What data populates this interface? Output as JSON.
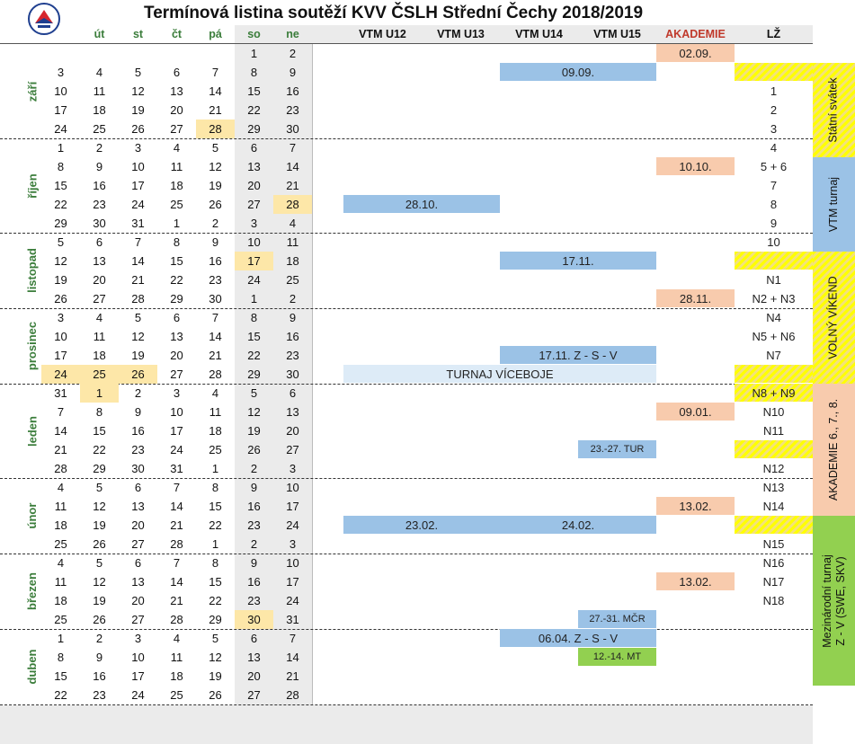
{
  "title": "Termínová listina soutěží KVV ČSLH Střední Čechy 2018/2019",
  "logo_icon": "cslh-logo-icon",
  "weekdays": [
    "út",
    "st",
    "čt",
    "pá",
    "so",
    "ne"
  ],
  "columns": [
    "VTM U12",
    "VTM U13",
    "VTM U14",
    "VTM U15",
    "AKADEMIE",
    "LŽ"
  ],
  "months": [
    {
      "name": "září",
      "weeks": [
        {
          "days": [
            "",
            "",
            "",
            "",
            "",
            "1",
            "2"
          ],
          "hl": []
        },
        {
          "days": [
            "3",
            "4",
            "5",
            "6",
            "7",
            "8",
            "9"
          ],
          "hl": []
        },
        {
          "days": [
            "10",
            "11",
            "12",
            "13",
            "14",
            "15",
            "16"
          ],
          "hl": []
        },
        {
          "days": [
            "17",
            "18",
            "19",
            "20",
            "21",
            "22",
            "23"
          ],
          "hl": []
        },
        {
          "days": [
            "24",
            "25",
            "26",
            "27",
            "28",
            "29",
            "30"
          ],
          "hl": [
            4
          ]
        }
      ]
    },
    {
      "name": "říjen",
      "weeks": [
        {
          "days": [
            "1",
            "2",
            "3",
            "4",
            "5",
            "6",
            "7"
          ],
          "hl": []
        },
        {
          "days": [
            "8",
            "9",
            "10",
            "11",
            "12",
            "13",
            "14"
          ],
          "hl": []
        },
        {
          "days": [
            "15",
            "16",
            "17",
            "18",
            "19",
            "20",
            "21"
          ],
          "hl": []
        },
        {
          "days": [
            "22",
            "23",
            "24",
            "25",
            "26",
            "27",
            "28"
          ],
          "hl": [
            6
          ]
        },
        {
          "days": [
            "29",
            "30",
            "31",
            "1",
            "2",
            "3",
            "4"
          ],
          "hl": []
        }
      ]
    },
    {
      "name": "listopad",
      "weeks": [
        {
          "days": [
            "5",
            "6",
            "7",
            "8",
            "9",
            "10",
            "11"
          ],
          "hl": []
        },
        {
          "days": [
            "12",
            "13",
            "14",
            "15",
            "16",
            "17",
            "18"
          ],
          "hl": [
            5
          ]
        },
        {
          "days": [
            "19",
            "20",
            "21",
            "22",
            "23",
            "24",
            "25"
          ],
          "hl": []
        },
        {
          "days": [
            "26",
            "27",
            "28",
            "29",
            "30",
            "1",
            "2"
          ],
          "hl": []
        }
      ]
    },
    {
      "name": "prosinec",
      "weeks": [
        {
          "days": [
            "3",
            "4",
            "5",
            "6",
            "7",
            "8",
            "9"
          ],
          "hl": []
        },
        {
          "days": [
            "10",
            "11",
            "12",
            "13",
            "14",
            "15",
            "16"
          ],
          "hl": []
        },
        {
          "days": [
            "17",
            "18",
            "19",
            "20",
            "21",
            "22",
            "23"
          ],
          "hl": []
        },
        {
          "days": [
            "24",
            "25",
            "26",
            "27",
            "28",
            "29",
            "30"
          ],
          "hl": [
            0,
            1,
            2
          ]
        }
      ]
    },
    {
      "name": "leden",
      "weeks": [
        {
          "days": [
            "31",
            "1",
            "2",
            "3",
            "4",
            "5",
            "6"
          ],
          "hl": [
            1
          ]
        },
        {
          "days": [
            "7",
            "8",
            "9",
            "10",
            "11",
            "12",
            "13"
          ],
          "hl": []
        },
        {
          "days": [
            "14",
            "15",
            "16",
            "17",
            "18",
            "19",
            "20"
          ],
          "hl": []
        },
        {
          "days": [
            "21",
            "22",
            "23",
            "24",
            "25",
            "26",
            "27"
          ],
          "hl": []
        },
        {
          "days": [
            "28",
            "29",
            "30",
            "31",
            "1",
            "2",
            "3"
          ],
          "hl": []
        }
      ]
    },
    {
      "name": "únor",
      "weeks": [
        {
          "days": [
            "4",
            "5",
            "6",
            "7",
            "8",
            "9",
            "10"
          ],
          "hl": []
        },
        {
          "days": [
            "11",
            "12",
            "13",
            "14",
            "15",
            "16",
            "17"
          ],
          "hl": []
        },
        {
          "days": [
            "18",
            "19",
            "20",
            "21",
            "22",
            "23",
            "24"
          ],
          "hl": []
        },
        {
          "days": [
            "25",
            "26",
            "27",
            "28",
            "1",
            "2",
            "3"
          ],
          "hl": []
        }
      ]
    },
    {
      "name": "březen",
      "weeks": [
        {
          "days": [
            "4",
            "5",
            "6",
            "7",
            "8",
            "9",
            "10"
          ],
          "hl": []
        },
        {
          "days": [
            "11",
            "12",
            "13",
            "14",
            "15",
            "16",
            "17"
          ],
          "hl": []
        },
        {
          "days": [
            "18",
            "19",
            "20",
            "21",
            "22",
            "23",
            "24"
          ],
          "hl": []
        },
        {
          "days": [
            "25",
            "26",
            "27",
            "28",
            "29",
            "30",
            "31"
          ],
          "hl": [
            5
          ]
        }
      ]
    },
    {
      "name": "duben",
      "weeks": [
        {
          "days": [
            "1",
            "2",
            "3",
            "4",
            "5",
            "6",
            "7"
          ],
          "hl": []
        },
        {
          "days": [
            "8",
            "9",
            "10",
            "11",
            "12",
            "13",
            "14"
          ],
          "hl": []
        },
        {
          "days": [
            "15",
            "16",
            "17",
            "18",
            "19",
            "20",
            "21"
          ],
          "hl": []
        },
        {
          "days": [
            "22",
            "23",
            "24",
            "25",
            "26",
            "27",
            "28"
          ],
          "hl": []
        }
      ]
    }
  ],
  "events": [
    {
      "row": 0,
      "col": 4,
      "span": 1,
      "text": "02.09.",
      "style": "salmon"
    },
    {
      "row": 1,
      "col": 2,
      "span": 2,
      "text": "09.09.",
      "style": "blue"
    },
    {
      "row": 6,
      "col": 4,
      "span": 1,
      "text": "10.10.",
      "style": "salmon"
    },
    {
      "row": 8,
      "col": 0,
      "span": 2,
      "text": "28.10.",
      "style": "blue"
    },
    {
      "row": 11,
      "col": 2,
      "span": 2,
      "text": "17.11.",
      "style": "blue"
    },
    {
      "row": 13,
      "col": 4,
      "span": 1,
      "text": "28.11.",
      "style": "salmon"
    },
    {
      "row": 16,
      "col": 2,
      "span": 2,
      "text": "17.11.  Z - S - V",
      "style": "blue"
    },
    {
      "row": 17,
      "col": 0,
      "span": 4,
      "text": "TURNAJ VÍCEBOJE",
      "style": "lightblue"
    },
    {
      "row": 19,
      "col": 4,
      "span": 1,
      "text": "09.01.",
      "style": "salmon"
    },
    {
      "row": 21,
      "col": 3,
      "span": 1,
      "text": "23.-27. TUR",
      "style": "blue",
      "small": true
    },
    {
      "row": 24,
      "col": 4,
      "span": 1,
      "text": "13.02.",
      "style": "salmon"
    },
    {
      "row": 25,
      "col": 0,
      "span": 2,
      "text": "23.02.",
      "style": "blue"
    },
    {
      "row": 25,
      "col": 2,
      "span": 2,
      "text": "24.02.",
      "style": "blue"
    },
    {
      "row": 28,
      "col": 4,
      "span": 1,
      "text": "13.02.",
      "style": "salmon"
    },
    {
      "row": 30,
      "col": 3,
      "span": 1,
      "text": "27.-31. MČR",
      "style": "blue",
      "small": true
    },
    {
      "row": 31,
      "col": 2,
      "span": 2,
      "text": "06.04.  Z - S - V",
      "style": "blue"
    },
    {
      "row": 32,
      "col": 3,
      "span": 1,
      "text": "12.-14. MT",
      "style": "green",
      "small": true
    }
  ],
  "lz": [
    {
      "row": 1,
      "text": "",
      "style": "yellow"
    },
    {
      "row": 2,
      "text": "1"
    },
    {
      "row": 3,
      "text": "2"
    },
    {
      "row": 4,
      "text": "3"
    },
    {
      "row": 5,
      "text": "4"
    },
    {
      "row": 6,
      "text": "5 + 6"
    },
    {
      "row": 7,
      "text": "7"
    },
    {
      "row": 8,
      "text": "8"
    },
    {
      "row": 9,
      "text": "9"
    },
    {
      "row": 10,
      "text": "10"
    },
    {
      "row": 11,
      "text": "",
      "style": "yellow"
    },
    {
      "row": 12,
      "text": "N1"
    },
    {
      "row": 13,
      "text": "N2 + N3"
    },
    {
      "row": 14,
      "text": "N4"
    },
    {
      "row": 15,
      "text": "N5 + N6"
    },
    {
      "row": 16,
      "text": "N7"
    },
    {
      "row": 17,
      "text": "",
      "style": "yellow"
    },
    {
      "row": 18,
      "text": "N8 + N9",
      "style": "yellow"
    },
    {
      "row": 19,
      "text": "N10"
    },
    {
      "row": 20,
      "text": "N11"
    },
    {
      "row": 21,
      "text": "",
      "style": "yellow"
    },
    {
      "row": 22,
      "text": "N12"
    },
    {
      "row": 23,
      "text": "N13"
    },
    {
      "row": 24,
      "text": "N14"
    },
    {
      "row": 25,
      "text": "",
      "style": "yellow"
    },
    {
      "row": 26,
      "text": "N15"
    },
    {
      "row": 27,
      "text": "N16"
    },
    {
      "row": 28,
      "text": "N17"
    },
    {
      "row": 29,
      "text": "N18"
    }
  ],
  "legend": [
    {
      "from": 1,
      "to": 5,
      "lines": [
        "Státní svátek"
      ],
      "style": "yellow"
    },
    {
      "from": 6,
      "to": 10,
      "lines": [
        "VTM  turnaj"
      ],
      "style": "blue"
    },
    {
      "from": 11,
      "to": 17,
      "lines": [
        "VOLNÝ VÍKEND"
      ],
      "style": "yellow"
    },
    {
      "from": 18,
      "to": 24,
      "lines": [
        "AKADEMIE 6., 7., 8."
      ],
      "style": "salmon"
    },
    {
      "from": 25,
      "to": 33,
      "lines": [
        "Mezinárodní turnaj",
        "Z - V (SWE, SKV)"
      ],
      "style": "green"
    }
  ]
}
